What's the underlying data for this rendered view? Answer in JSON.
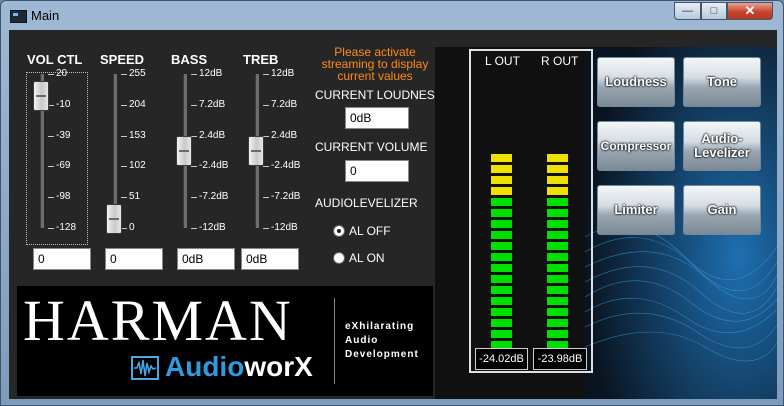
{
  "window": {
    "title": "Main",
    "min_glyph": "—",
    "max_glyph": "□",
    "close_glyph": "✕"
  },
  "sliders": {
    "volctl": {
      "label": "VOL CTL",
      "ticks": [
        "20",
        "-10",
        "-39",
        "-69",
        "-98",
        "-128"
      ],
      "value": "0",
      "level": 0.86
    },
    "speed": {
      "label": "SPEED",
      "ticks": [
        "255",
        "204",
        "153",
        "102",
        "51",
        "0"
      ],
      "value": "0",
      "level": 0.0
    },
    "bass": {
      "label": "BASS",
      "ticks": [
        "12dB",
        "7.2dB",
        "2.4dB",
        "-2.4dB",
        "-7.2dB",
        "-12dB"
      ],
      "value": "0dB",
      "level": 0.5
    },
    "treb": {
      "label": "TREB",
      "ticks": [
        "12dB",
        "7.2dB",
        "2.4dB",
        "-2.4dB",
        "-7.2dB",
        "-12dB"
      ],
      "value": "0dB",
      "level": 0.5
    }
  },
  "status": {
    "line1": "Please activate",
    "line2": "streaming to display",
    "line3": "current values",
    "loudness_label": "CURRENT LOUDNESS",
    "loudness_value": "0dB",
    "volume_label": "CURRENT VOLUME",
    "volume_value": "0",
    "audiolevelizer_label": "AUDIOLEVELIZER",
    "al_off": "AL OFF",
    "al_on": "AL ON",
    "selected": "AL OFF"
  },
  "logo": {
    "brand": "HARMAN",
    "product_a": "Audio",
    "product_b": "worX",
    "tagline_1": "eXhilarating",
    "tagline_2": "Audio",
    "tagline_3": "Development"
  },
  "vu": {
    "left_label": "L OUT",
    "right_label": "R OUT",
    "left_value": "-24.02dB",
    "right_value": "-23.98dB",
    "left_lit_yellow": 4,
    "right_lit_yellow": 4,
    "green_segments": 14,
    "colors": {
      "yellow": "#f0e000",
      "green": "#00e000"
    }
  },
  "buttons": {
    "loudness": "Loudness",
    "tone": "Tone",
    "compressor": "Compressor",
    "audiolevelizer": "Audio-\nLevelizer",
    "limiter": "Limiter",
    "gain": "Gain"
  }
}
